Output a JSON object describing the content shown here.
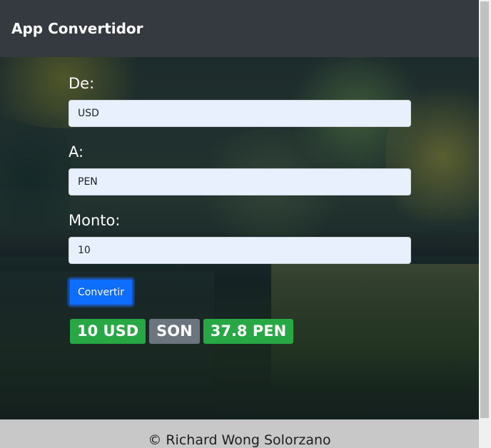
{
  "navbar": {
    "brand": "App Convertidor"
  },
  "form": {
    "from_label": "De:",
    "from_value": "USD",
    "to_label": "A:",
    "to_value": "PEN",
    "amount_label": "Monto:",
    "amount_value": "10",
    "convert_button": "Convertir"
  },
  "result": {
    "source": "10 USD",
    "equals": "SON",
    "target": "37.8 PEN"
  },
  "footer": {
    "text": "© Richard Wong Solorzano"
  },
  "colors": {
    "navbar": "#343a40",
    "button": "#0d6efd",
    "badge_green": "#28a745",
    "badge_gray": "#6c757d",
    "input_bg": "#e8f0fe"
  }
}
